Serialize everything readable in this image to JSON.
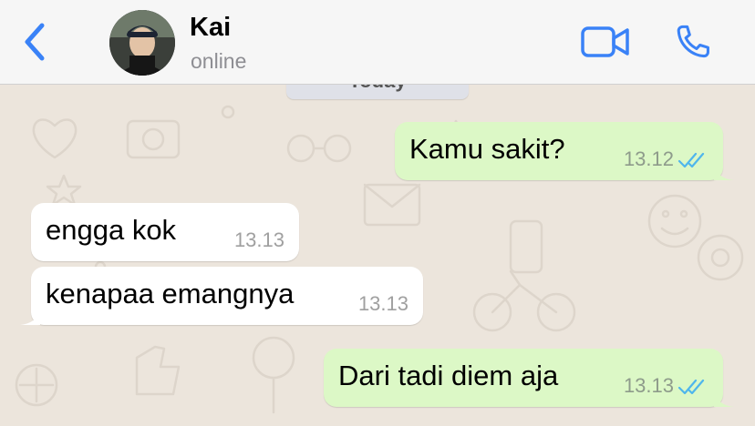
{
  "header": {
    "back_icon": "chevron-left-icon",
    "contact_name": "Kai",
    "contact_status": "online",
    "video_call_icon": "video-camera-icon",
    "voice_call_icon": "phone-icon"
  },
  "chat": {
    "date_separator": "Today",
    "messages": [
      {
        "direction": "outgoing",
        "text": "Kamu sakit?",
        "time": "13.12",
        "status": "read"
      },
      {
        "direction": "incoming",
        "text": "engga kok",
        "time": "13.13"
      },
      {
        "direction": "incoming",
        "text": "kenapaa emangnya",
        "time": "13.13"
      },
      {
        "direction": "outgoing",
        "text": "Dari tadi diem aja",
        "time": "13.13",
        "status": "read"
      }
    ]
  },
  "colors": {
    "accent_blue": "#3a82f7",
    "outgoing_bubble": "#dcf8c6",
    "incoming_bubble": "#ffffff",
    "wallpaper": "#ece5dc",
    "read_ticks": "#4fb6ec"
  }
}
